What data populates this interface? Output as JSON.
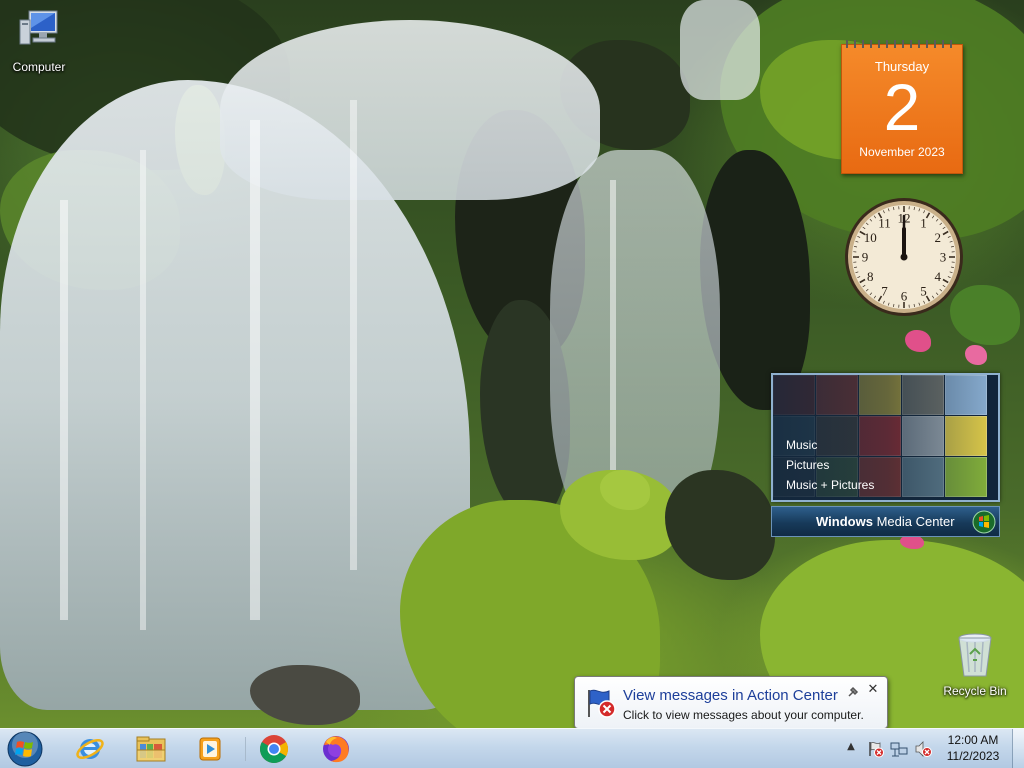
{
  "desktop": {
    "icons": [
      {
        "label": "Computer",
        "icon": "computer-icon"
      },
      {
        "label": "Recycle Bin",
        "icon": "recycle-bin-icon"
      }
    ]
  },
  "gadgets": {
    "calendar": {
      "day_name": "Thursday",
      "day_number": "2",
      "month_year": "November 2023",
      "color": "#ee7418"
    },
    "clock": {
      "numbers": [
        "12",
        "1",
        "2",
        "3",
        "4",
        "5",
        "6",
        "7",
        "8",
        "9",
        "10",
        "11"
      ],
      "hour": 12,
      "minute": 0
    },
    "media_center": {
      "menu": [
        "Music",
        "Pictures",
        "Music + Pictures"
      ],
      "brand_windows": "Windows",
      "brand_rest": "Media Center"
    }
  },
  "notification": {
    "title": "View messages in Action Center",
    "text": "Click to view messages about your computer.",
    "icon": "action-center-flag-icon"
  },
  "taskbar": {
    "start_icon": "windows-start-orb-icon",
    "pinned": [
      {
        "name": "Internet Explorer",
        "icon": "internet-explorer-icon"
      },
      {
        "name": "Windows Explorer",
        "icon": "file-explorer-icon"
      },
      {
        "name": "Windows Media Player",
        "icon": "media-player-icon"
      },
      {
        "name": "Google Chrome",
        "icon": "chrome-icon"
      },
      {
        "name": "Mozilla Firefox",
        "icon": "firefox-icon"
      }
    ],
    "tray": {
      "show_hidden": "▲",
      "icons": [
        "action-center-flag-icon",
        "network-icon",
        "volume-muted-icon"
      ],
      "time": "12:00 AM",
      "date": "11/2/2023"
    }
  }
}
